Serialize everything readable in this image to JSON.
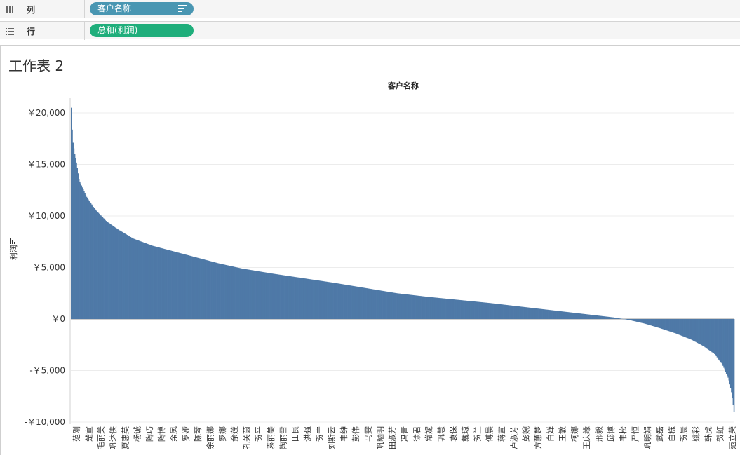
{
  "shelves": {
    "columns": {
      "icon": "columns-icon",
      "label": "列",
      "pill": "客户名称"
    },
    "rows": {
      "icon": "rows-icon",
      "label": "行",
      "pill": "总和(利润)"
    }
  },
  "sheet": {
    "title": "工作表 2"
  },
  "colors": {
    "bar": "#4e79a7",
    "pill_columns": "#4996b2",
    "pill_rows": "#1fae7b"
  },
  "chart_data": {
    "type": "bar",
    "title": "客户名称",
    "ylabel": "利润",
    "ylim": [
      -10000,
      21000
    ],
    "yticks": [
      20000,
      15000,
      10000,
      5000,
      0,
      -5000,
      -10000
    ],
    "ytick_labels": [
      "￥20,000",
      "￥15,000",
      "￥10,000",
      "￥5,000",
      "￥0",
      "-￥5,000",
      "-￥10,000"
    ],
    "bar_count": 784,
    "x_labels": [
      "范刚",
      "楚宣",
      "毛丽美",
      "巩达侠",
      "夏惠英",
      "杨诚",
      "陶巧",
      "陶博",
      "余凤",
      "罗娅",
      "陈琴",
      "余丽娜",
      "罗娜",
      "余莲",
      "孔关茵",
      "贺平",
      "袁丽美",
      "陶丽雪",
      "田良",
      "洪强",
      "贺宁",
      "刘斯云",
      "韦绅",
      "彭伟",
      "马雯",
      "巩晒明",
      "田淑芳",
      "冯青",
      "徐君",
      "常妮",
      "巩慧",
      "袁保",
      "戴琼",
      "贺兰",
      "傅晨",
      "蒋宣",
      "卢淑芳",
      "彭婉",
      "方蕙楚",
      "白婵",
      "王敏",
      "柯娜",
      "王庆缘",
      "邢毅",
      "邱博",
      "韦松",
      "严恒",
      "巩明娟",
      "武磊",
      "白栋",
      "贺晨",
      "姚彩",
      "韩虎",
      "贺虹",
      "范立荣"
    ],
    "shape_knots": [
      [
        0,
        20500
      ],
      [
        1,
        18500
      ],
      [
        2,
        17200
      ],
      [
        4,
        16200
      ],
      [
        7,
        15000
      ],
      [
        10,
        13500
      ],
      [
        14,
        12800
      ],
      [
        20,
        11800
      ],
      [
        30,
        10700
      ],
      [
        45,
        9500
      ],
      [
        60,
        8700
      ],
      [
        80,
        7800
      ],
      [
        105,
        7100
      ],
      [
        130,
        6600
      ],
      [
        160,
        6000
      ],
      [
        190,
        5400
      ],
      [
        220,
        4900
      ],
      [
        260,
        4400
      ],
      [
        300,
        3950
      ],
      [
        340,
        3500
      ],
      [
        380,
        3000
      ],
      [
        420,
        2500
      ],
      [
        460,
        2150
      ],
      [
        500,
        1850
      ],
      [
        540,
        1550
      ],
      [
        580,
        1200
      ],
      [
        620,
        850
      ],
      [
        660,
        500
      ],
      [
        700,
        150
      ],
      [
        720,
        -100
      ],
      [
        740,
        -450
      ],
      [
        760,
        -900
      ],
      [
        780,
        -1400
      ],
      [
        800,
        -2000
      ],
      [
        815,
        -2600
      ],
      [
        830,
        -3400
      ],
      [
        840,
        -4400
      ],
      [
        848,
        -5800
      ],
      [
        852,
        -7200
      ],
      [
        855,
        -9000
      ]
    ],
    "shape_scale_max": 855,
    "grid": true
  }
}
